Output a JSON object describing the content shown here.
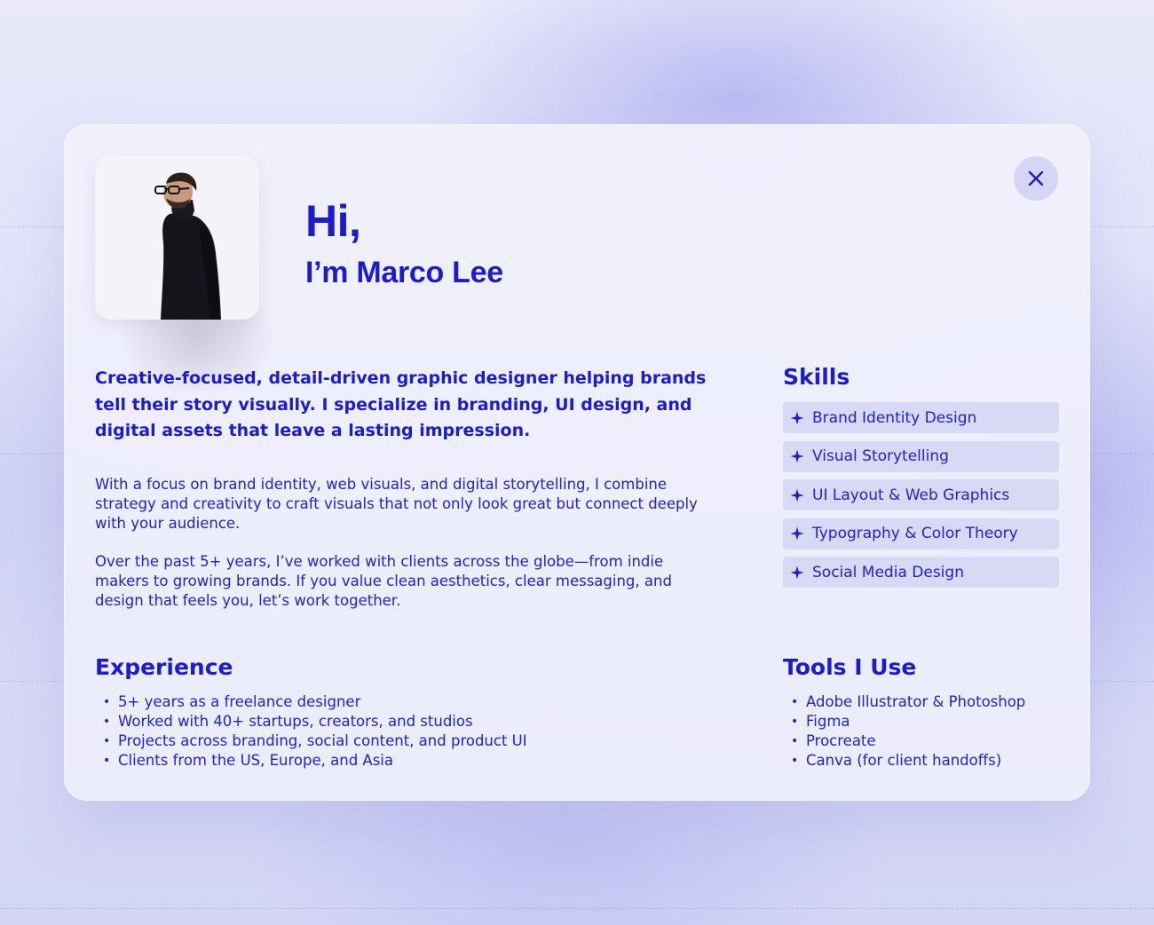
{
  "profile": {
    "greeting": "Hi,",
    "name": "I’m Marco Lee",
    "photo_alt": "Portrait of Marco Lee"
  },
  "about": {
    "lead": "Creative-focused, detail-driven graphic designer helping brands tell their story visually. I specialize in branding, UI design, and digital assets that leave a lasting impression.",
    "paragraphs": [
      "With a focus on brand identity, web visuals, and digital storytelling, I combine strategy and creativity to craft visuals that not only look great but connect deeply with your audience.",
      "Over the past 5+ years, I’ve worked with clients across the globe—from indie makers to growing brands. If you value clean aesthetics, clear messaging, and design that feels you, let’s work together."
    ]
  },
  "experience": {
    "title": "Experience",
    "items": [
      "5+ years as a freelance designer",
      "Worked with 40+ startups, creators, and studios",
      "Projects across branding, social content, and product UI",
      "Clients from the US, Europe, and Asia"
    ]
  },
  "skills": {
    "title": "Skills",
    "icon": "sparkle-icon",
    "items": [
      "Brand Identity Design",
      "Visual Storytelling",
      "UI Layout & Web Graphics",
      "Typography & Color Theory",
      "Social Media Design"
    ]
  },
  "tools": {
    "title": "Tools I Use",
    "items": [
      "Adobe Illustrator & Photoshop",
      "Figma",
      "Procreate",
      "Canva (for client handoffs)"
    ]
  },
  "controls": {
    "close_icon": "close-icon"
  },
  "colors": {
    "accent": "#1d1ccc",
    "chip_bg": "#d8d9f4",
    "close_bg": "#d5d6f5",
    "card_bg": "#efeffc"
  }
}
